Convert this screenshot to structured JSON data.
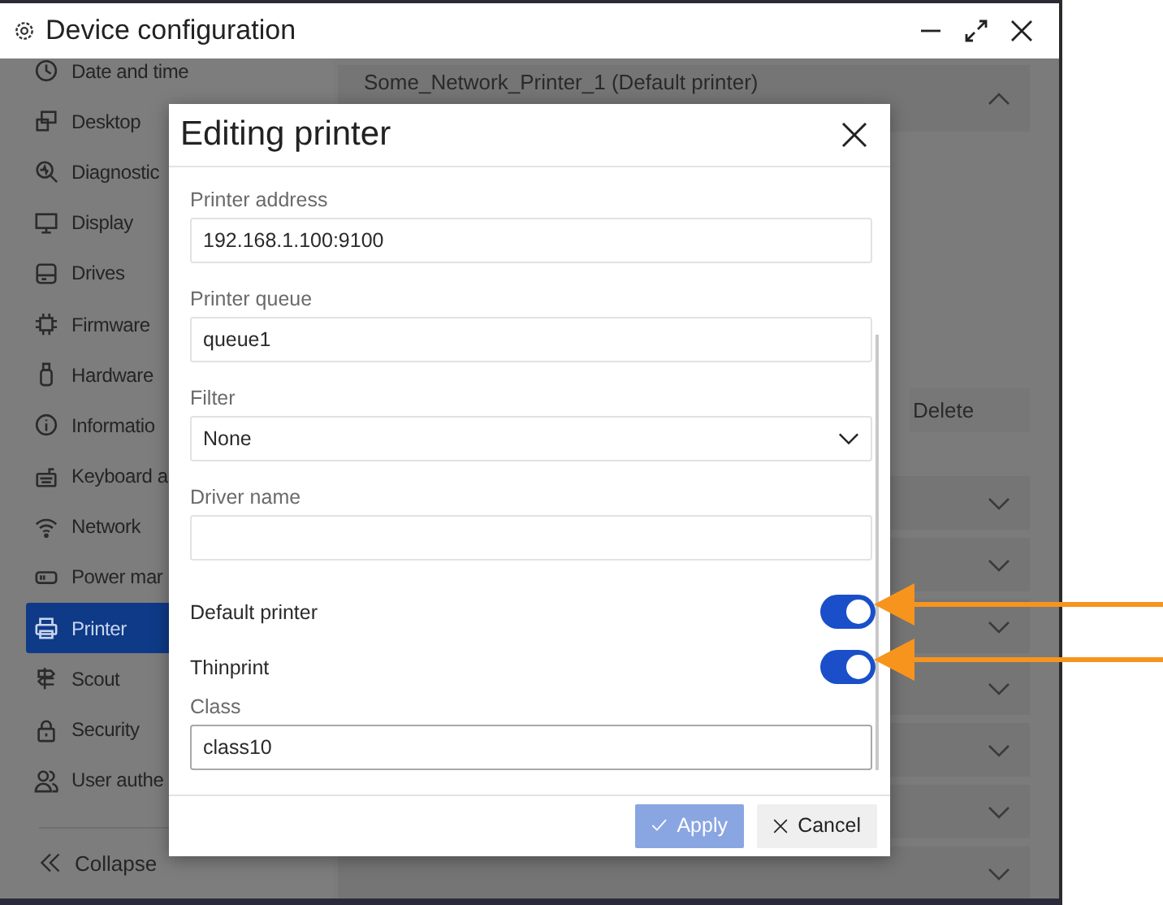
{
  "window": {
    "title": "Device configuration"
  },
  "sidebar": {
    "items": [
      {
        "label": "Date and time",
        "selected": false
      },
      {
        "label": "Desktop",
        "selected": false
      },
      {
        "label": "Diagnostic",
        "selected": false
      },
      {
        "label": "Display",
        "selected": false
      },
      {
        "label": "Drives",
        "selected": false
      },
      {
        "label": "Firmware",
        "selected": false
      },
      {
        "label": "Hardware",
        "selected": false
      },
      {
        "label": "Informatio",
        "selected": false
      },
      {
        "label": "Keyboard a",
        "selected": false
      },
      {
        "label": "Network",
        "selected": false
      },
      {
        "label": "Power mar",
        "selected": false
      },
      {
        "label": "Printer",
        "selected": true
      },
      {
        "label": "Scout",
        "selected": false
      },
      {
        "label": "Security",
        "selected": false
      },
      {
        "label": "User authe",
        "selected": false
      }
    ],
    "collapse": "Collapse"
  },
  "main": {
    "printers": [
      {
        "name": "Some_Network_Printer_1 (Default printer)",
        "expanded": true
      },
      {
        "expanded": false
      },
      {
        "expanded": false
      },
      {
        "expanded": false
      },
      {
        "expanded": false
      },
      {
        "expanded": false
      },
      {
        "expanded": false
      },
      {
        "expanded": false
      }
    ],
    "delete": "Delete"
  },
  "dialog": {
    "title": "Editing printer",
    "fields": [
      {
        "kind": "text",
        "label": "Printer address",
        "value": "192.168.1.100:9100"
      },
      {
        "kind": "text",
        "label": "Printer queue",
        "value": "queue1"
      },
      {
        "kind": "select",
        "label": "Filter",
        "value": "None"
      },
      {
        "kind": "text",
        "label": "Driver name"
      },
      {
        "kind": "toggle",
        "label": "Default printer",
        "on": true
      },
      {
        "kind": "toggle",
        "label": "Thinprint",
        "on": true
      },
      {
        "kind": "text",
        "label": "Class",
        "value": "class10",
        "focused": true
      }
    ],
    "buttons": [
      {
        "kind": "apply",
        "label": "Apply",
        "disabled": true
      },
      {
        "kind": "cancel",
        "label": "Cancel",
        "disabled": false
      }
    ]
  }
}
